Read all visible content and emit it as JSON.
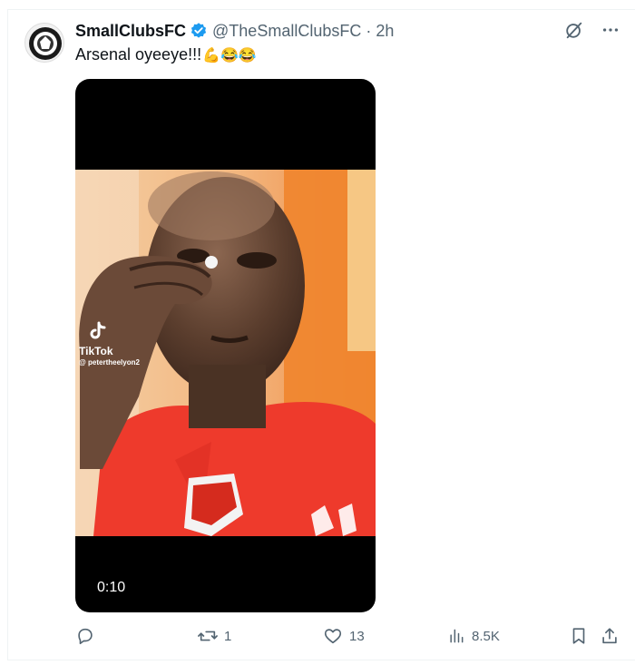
{
  "post": {
    "display_name": "SmallClubsFC",
    "handle": "@TheSmallClubsFC",
    "separator": "·",
    "time_ago": "2h",
    "text": "Arsenal oyeeye!!!",
    "emojis": "💪😂😂"
  },
  "media": {
    "watermark_brand": "TikTok",
    "watermark_user": "@ petertheelyon2",
    "duration": "0:10"
  },
  "actions": {
    "reply_count": "",
    "repost_count": "1",
    "like_count": "13",
    "views_count": "8.5K"
  },
  "colors": {
    "text_primary": "#0f1419",
    "text_secondary": "#536471",
    "verified": "#1d9bf0",
    "jersey_red": "#ee3a2c"
  },
  "icons": [
    "grok-icon",
    "more-icon",
    "reply-icon",
    "repost-icon",
    "like-icon",
    "views-icon",
    "bookmark-icon",
    "share-icon",
    "verified-badge-icon",
    "tiktok-icon"
  ]
}
